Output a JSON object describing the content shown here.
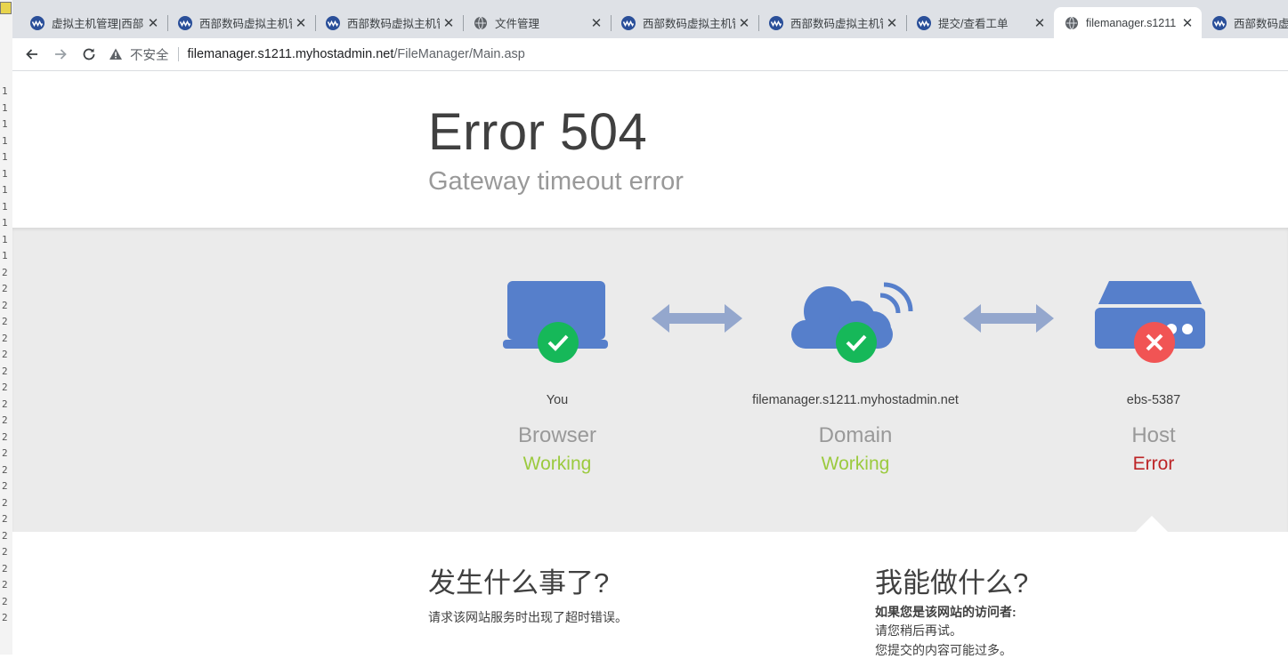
{
  "left_strip": {
    "line_numbers": [
      "1",
      "1",
      "1",
      "1",
      "1",
      "1",
      "1",
      "1",
      "1",
      "1",
      "1",
      "2",
      "2",
      "2",
      "2",
      "2",
      "2",
      "2",
      "2",
      "2",
      "2",
      "2",
      "2",
      "2",
      "2",
      "2",
      "2",
      "2",
      "2",
      "2",
      "2",
      "2",
      "2"
    ]
  },
  "tabs": [
    {
      "title": "虚拟主机管理|西部",
      "icon": "west-digital-icon"
    },
    {
      "title": "西部数码虚拟主机管",
      "icon": "west-digital-icon"
    },
    {
      "title": "西部数码虚拟主机管",
      "icon": "west-digital-icon"
    },
    {
      "title": "文件管理",
      "icon": "globe-icon"
    },
    {
      "title": "西部数码虚拟主机管",
      "icon": "west-digital-icon"
    },
    {
      "title": "西部数码虚拟主机管",
      "icon": "west-digital-icon"
    },
    {
      "title": "提交/查看工单",
      "icon": "west-digital-icon"
    },
    {
      "title": "filemanager.s1211",
      "icon": "globe-icon",
      "active": true
    },
    {
      "title": "西部数码虚拟主",
      "icon": "west-digital-icon"
    }
  ],
  "toolbar": {
    "insecure_label": "不安全",
    "url_host": "filemanager.s1211.myhostadmin.net",
    "url_path": "/FileManager/Main.asp"
  },
  "error": {
    "code": "Error 504",
    "title": "Gateway timeout error"
  },
  "nodes": [
    {
      "location": "You",
      "name": "Browser",
      "status": "Working",
      "ok": true
    },
    {
      "location": "filemanager.s1211.myhostadmin.net",
      "name": "Domain",
      "status": "Working",
      "ok": true
    },
    {
      "location": "ebs-5387",
      "name": "Host",
      "status": "Error",
      "ok": false
    }
  ],
  "colors": {
    "icon_blue": "#567fcb",
    "arrow": "#94a7cd",
    "ok_badge": "#16b859",
    "err_badge": "#f15454",
    "ok_text": "#9bca3e",
    "err_text": "#bd2426"
  },
  "info": {
    "what_happened_title": "发生什么事了?",
    "what_happened_text": "请求该网站服务时出现了超时错误。",
    "what_can_i_do_title": "我能做什么?",
    "visitor_heading": "如果您是该网站的访问者:",
    "visitor_line1": "请您稍后再试。",
    "visitor_line2": "您提交的内容可能过多。"
  }
}
